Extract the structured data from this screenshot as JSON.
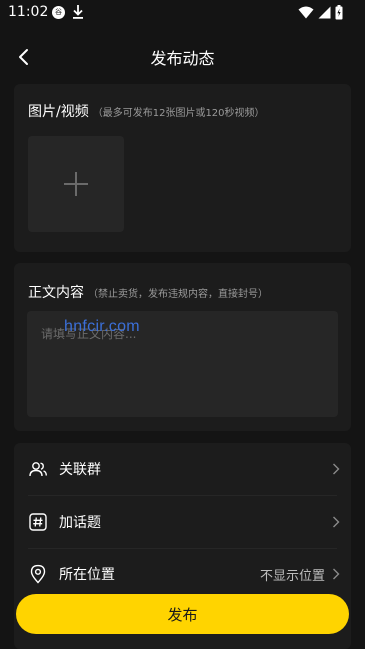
{
  "status_bar": {
    "time": "11:02",
    "badge": "谷",
    "icons": [
      "download-icon",
      "wifi-icon",
      "signal-icon",
      "battery-icon"
    ]
  },
  "header": {
    "title": "发布动态",
    "back_icon": "chevron-left-icon"
  },
  "media_section": {
    "title": "图片/视频",
    "note": "（最多可发布12张图片或120秒视频）",
    "add_icon": "plus-icon"
  },
  "content_section": {
    "title": "正文内容",
    "note": "（禁止卖货，发布违规内容，直接封号）",
    "placeholder": "请填写正文内容...",
    "value": "",
    "watermark": "hnfcir.com"
  },
  "options": [
    {
      "icon": "group-users-icon",
      "label": "关联群",
      "value": ""
    },
    {
      "icon": "hashtag-icon",
      "label": "加话题",
      "value": ""
    },
    {
      "icon": "location-pin-icon",
      "label": "所在位置",
      "value": "不显示位置"
    }
  ],
  "publish_button": {
    "label": "发布"
  },
  "colors": {
    "background": "#141414",
    "card": "#1c1c1c",
    "input": "#262626",
    "accent": "#ffd400",
    "watermark": "#3b6fd8"
  }
}
